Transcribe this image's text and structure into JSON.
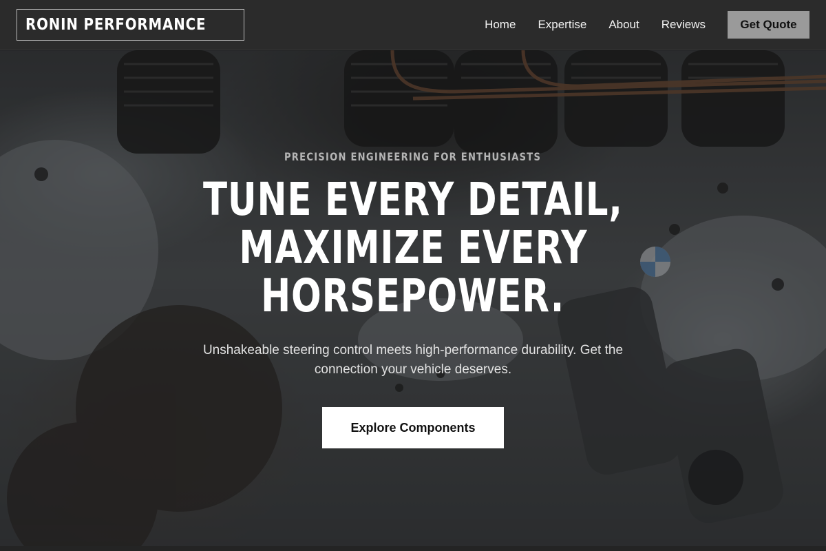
{
  "header": {
    "logo": "RONIN PERFORMANCE",
    "nav": [
      {
        "label": "Home"
      },
      {
        "label": "Expertise"
      },
      {
        "label": "About"
      },
      {
        "label": "Reviews"
      }
    ],
    "cta_label": "Get Quote"
  },
  "hero": {
    "eyebrow": "PRECISION ENGINEERING FOR ENTHUSIASTS",
    "headline_lines": [
      "TUNE EVERY DETAIL,",
      "MAXIMIZE EVERY",
      "HORSEPOWER."
    ],
    "subtext": "Unshakeable steering control meets high-performance durability. Get the connection your vehicle deserves.",
    "cta_label": "Explore Components",
    "background_image": "engine-photo"
  },
  "colors": {
    "header_bg": "#2b2b2b",
    "quote_button_bg": "#9a9a9a",
    "cta_bg": "#ffffff",
    "text_primary": "#ffffff"
  }
}
